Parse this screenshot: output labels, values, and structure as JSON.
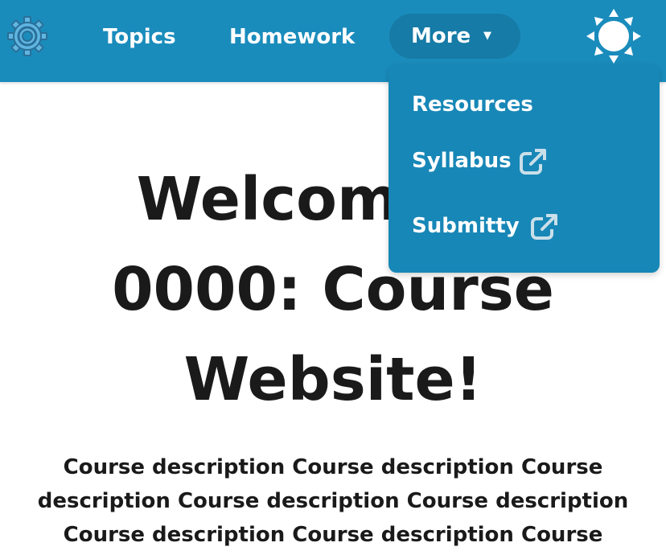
{
  "nav": {
    "settings_icon": "gear-icon",
    "items": [
      {
        "label": "Topics"
      },
      {
        "label": "Homework"
      }
    ],
    "more": {
      "label": "More",
      "caret": "▼"
    },
    "theme_icon": "sun-icon"
  },
  "dropdown": {
    "items": [
      {
        "label": "Resources",
        "external": false
      },
      {
        "label": "Syllabus",
        "external": true,
        "icon": "external-link-icon"
      },
      {
        "label": "Submitty",
        "external": true,
        "icon": "external-link-icon"
      }
    ]
  },
  "main": {
    "title_lines": [
      "Welcome to",
      "0000: Course",
      "Website!"
    ],
    "description": "Course description Course description Course description Course description Course description Course description Course description Course"
  },
  "colors": {
    "navbar": "#1a8cbc",
    "pill": "#167ba6",
    "dropdown": "#1787b7",
    "text": "#1a1a1a",
    "gear": "#2a6f98"
  }
}
